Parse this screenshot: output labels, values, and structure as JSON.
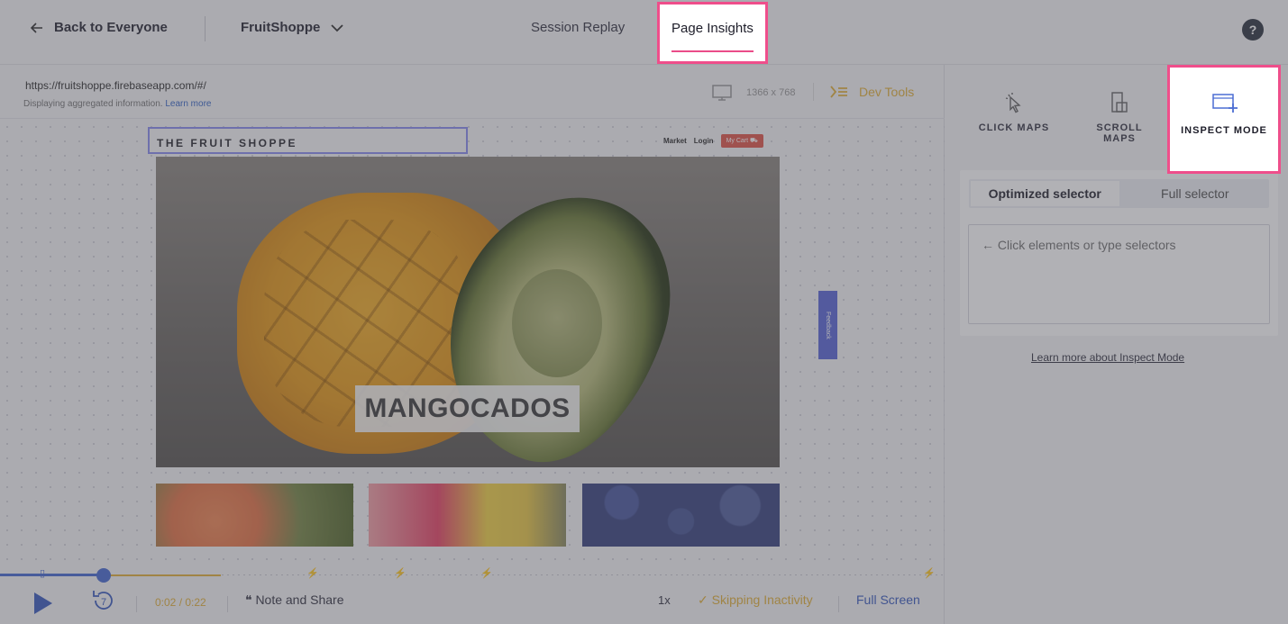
{
  "header": {
    "back_label": "Back to Everyone",
    "site_name": "FruitShoppe",
    "tab_session_replay": "Session Replay",
    "tab_page_insights": "Page Insights",
    "help_label": "?"
  },
  "toolbar": {
    "url": "https://fruitshoppe.firebaseapp.com/#/",
    "aggregated_text": "Displaying aggregated information.",
    "learn_more": "Learn more",
    "resolution": "1366 x 768",
    "dev_tools": "Dev Tools"
  },
  "site_preview": {
    "title": "THE FRUIT SHOPPE",
    "nav_market": "Market",
    "nav_login": "Login",
    "cart": "My Cart",
    "hero_label": "MANGOCADOS",
    "feedback": "Feedback"
  },
  "player": {
    "current_time": "0:02",
    "total_time": "0:22",
    "time_separator": " / ",
    "replay_seconds": "7",
    "note_and_share": "Note and Share",
    "speed": "1x",
    "skipping": "Skipping Inactivity",
    "full_screen": "Full Screen",
    "progress": 0.11
  },
  "panel": {
    "click_maps": "CLICK MAPS",
    "scroll_maps": "SCROLL MAPS",
    "inspect_mode": "INSPECT MODE",
    "tab_optimized": "Optimized selector",
    "tab_full": "Full selector",
    "selector_placeholder": "← Click elements or type selectors",
    "learn_more_inspect": "Learn more about Inspect Mode"
  },
  "colors": {
    "highlight": "#ef4e8b",
    "accent_blue": "#4b6dd3",
    "accent_yellow": "#e2b23e"
  }
}
